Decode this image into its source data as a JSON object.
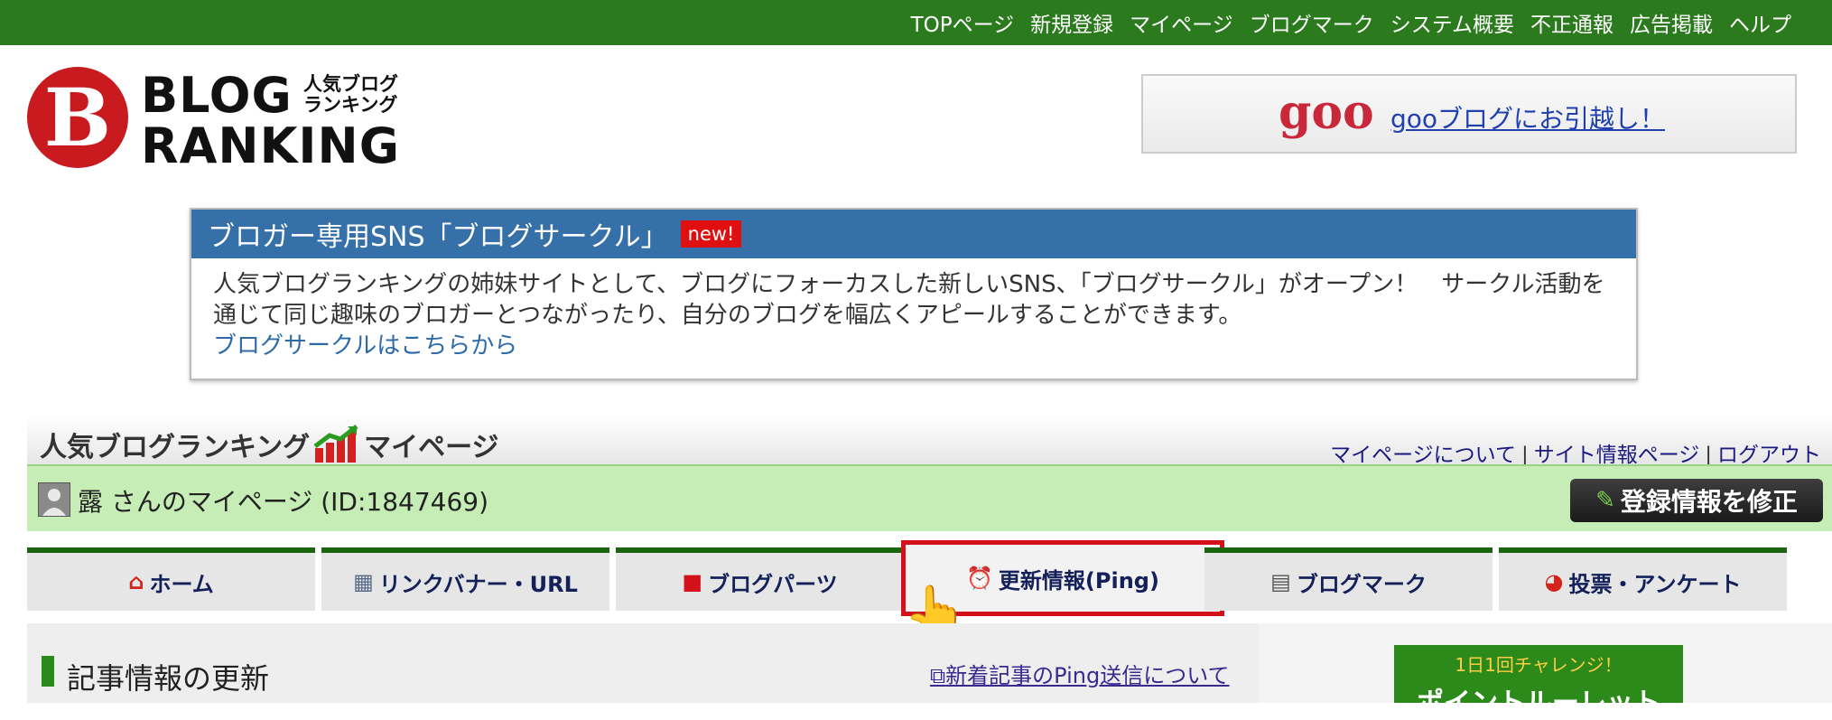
{
  "topnav": [
    "TOPページ",
    "新規登録",
    "マイページ",
    "ブログマーク",
    "システム概要",
    "不正通報",
    "広告掲載",
    "ヘルプ"
  ],
  "logo": {
    "mark": "B",
    "line1": "BLOG",
    "line2": "RANKING",
    "sub1": "人気ブログ",
    "sub2": "ランキング"
  },
  "goo_banner": {
    "logo": "goo",
    "link": "gooブログにお引越し！"
  },
  "sns": {
    "title": "ブロガー専用SNS「ブログサークル」",
    "badge": "new!",
    "body": "人気ブログランキングの姉妹サイトとして、ブログにフォーカスした新しいSNS、「ブログサークル」がオープン！　サークル活動を通じて同じ趣味のブロガーとつながったり、自分のブログを幅広くアピールすることができます。",
    "link": "ブログサークルはこちらから"
  },
  "mypage": {
    "title_left": "人気ブログランキング",
    "title_right": "マイページ",
    "links": [
      "マイページについて",
      "サイト情報ページ",
      "ログアウト"
    ]
  },
  "user": {
    "greeting": "露 さんのマイページ  (ID:1847469)",
    "edit_button": "登録情報を修正"
  },
  "tabs": [
    {
      "label": "ホーム",
      "icon": "home-icon"
    },
    {
      "label": "リンクバナー・URL",
      "icon": "banner-icon"
    },
    {
      "label": "ブログパーツ",
      "icon": "parts-icon"
    },
    {
      "label": "更新情報(Ping)",
      "icon": "alarm-clock-icon",
      "active": true
    },
    {
      "label": "ブログマーク",
      "icon": "clipboard-icon"
    },
    {
      "label": "投票・アンケート",
      "icon": "pie-chart-icon"
    }
  ],
  "content": {
    "section_title": "記事情報の更新",
    "ping_link": "新着記事のPing送信について",
    "roulette_small": "1日1回チャレンジ！",
    "roulette_big": "ポイントルーレット"
  },
  "colors": {
    "top_bar": "#2b7a1d",
    "sns_header": "#3670a8",
    "tab_active_outline": "#d4111b",
    "user_bar": "#c5edb5"
  }
}
